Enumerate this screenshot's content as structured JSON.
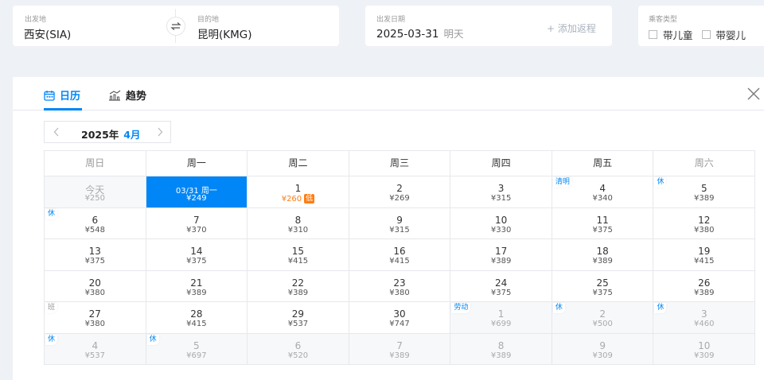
{
  "search": {
    "from_label": "出发地",
    "from_value": "西安(SIA)",
    "to_label": "目的地",
    "to_value": "昆明(KMG)",
    "date_label": "出发日期",
    "date_value": "2025-03-31",
    "date_hint": "明天",
    "add_return": "+ 添加返程",
    "pax_label": "乘客类型",
    "pax_child": "带儿童",
    "pax_infant": "带婴儿"
  },
  "tabs": {
    "calendar": "日历",
    "trend": "趋势"
  },
  "month": {
    "year": "2025年",
    "month": "4月"
  },
  "weekdays": [
    "周日",
    "周一",
    "周二",
    "周三",
    "周四",
    "周五",
    "周六"
  ],
  "weeks": [
    [
      {
        "day": "今天",
        "price": "¥250",
        "state": "dis"
      },
      {
        "day": "03/31 周一",
        "price": "¥249",
        "state": "sel"
      },
      {
        "day": "1",
        "price": "¥260",
        "state": "low",
        "low_tag": "低"
      },
      {
        "day": "2",
        "price": "¥269"
      },
      {
        "day": "3",
        "price": "¥315"
      },
      {
        "day": "4",
        "price": "¥340",
        "tag": "清明"
      },
      {
        "day": "5",
        "price": "¥389",
        "tag": "休"
      }
    ],
    [
      {
        "day": "6",
        "price": "¥548",
        "tag": "休"
      },
      {
        "day": "7",
        "price": "¥370"
      },
      {
        "day": "8",
        "price": "¥310"
      },
      {
        "day": "9",
        "price": "¥315"
      },
      {
        "day": "10",
        "price": "¥330"
      },
      {
        "day": "11",
        "price": "¥375"
      },
      {
        "day": "12",
        "price": "¥380"
      }
    ],
    [
      {
        "day": "13",
        "price": "¥375"
      },
      {
        "day": "14",
        "price": "¥375"
      },
      {
        "day": "15",
        "price": "¥415"
      },
      {
        "day": "16",
        "price": "¥415"
      },
      {
        "day": "17",
        "price": "¥389"
      },
      {
        "day": "18",
        "price": "¥389"
      },
      {
        "day": "19",
        "price": "¥415"
      }
    ],
    [
      {
        "day": "20",
        "price": "¥380"
      },
      {
        "day": "21",
        "price": "¥389"
      },
      {
        "day": "22",
        "price": "¥389"
      },
      {
        "day": "23",
        "price": "¥380"
      },
      {
        "day": "24",
        "price": "¥375"
      },
      {
        "day": "25",
        "price": "¥375"
      },
      {
        "day": "26",
        "price": "¥389"
      }
    ],
    [
      {
        "day": "27",
        "price": "¥380",
        "tag": "班"
      },
      {
        "day": "28",
        "price": "¥415"
      },
      {
        "day": "29",
        "price": "¥537"
      },
      {
        "day": "30",
        "price": "¥747"
      },
      {
        "day": "1",
        "price": "¥699",
        "state": "dis",
        "tag": "劳动"
      },
      {
        "day": "2",
        "price": "¥500",
        "state": "dis",
        "tag": "休"
      },
      {
        "day": "3",
        "price": "¥460",
        "state": "dis",
        "tag": "休"
      }
    ],
    [
      {
        "day": "4",
        "price": "¥537",
        "state": "dis",
        "tag": "休"
      },
      {
        "day": "5",
        "price": "¥697",
        "state": "dis",
        "tag": "休"
      },
      {
        "day": "6",
        "price": "¥520",
        "state": "dis"
      },
      {
        "day": "7",
        "price": "¥389",
        "state": "dis"
      },
      {
        "day": "8",
        "price": "¥389",
        "state": "dis"
      },
      {
        "day": "9",
        "price": "¥309",
        "state": "dis"
      },
      {
        "day": "10",
        "price": "¥309",
        "state": "dis"
      }
    ]
  ]
}
